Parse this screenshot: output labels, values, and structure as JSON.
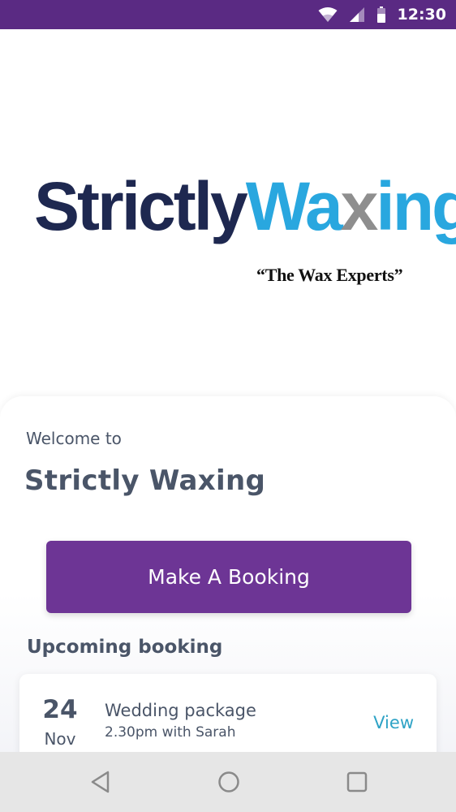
{
  "status_bar": {
    "time": "12:30",
    "icons": [
      "wifi-icon",
      "signal-icon",
      "battery-icon"
    ],
    "background": "#5a2a83"
  },
  "logo": {
    "part_strictly": "Strictly",
    "part_wa": "Wa",
    "part_x": "x",
    "part_ing": "ing",
    "tagline": "“The Wax Experts”",
    "colors": {
      "dark": "#1e2850",
      "blue": "#29a7df",
      "x": "#8e8e8e"
    }
  },
  "welcome": {
    "greeting": "Welcome to",
    "business_name": "Strictly Waxing"
  },
  "booking_button": {
    "label": "Make A Booking",
    "color": "#6d3595"
  },
  "upcoming": {
    "heading": "Upcoming booking",
    "booking": {
      "day": "24",
      "month": "Nov",
      "service": "Wedding package",
      "detail": "2.30pm with Sarah",
      "action_label": "View"
    }
  },
  "nav_bar": {
    "buttons": [
      "back-icon",
      "home-icon",
      "recents-icon"
    ]
  }
}
